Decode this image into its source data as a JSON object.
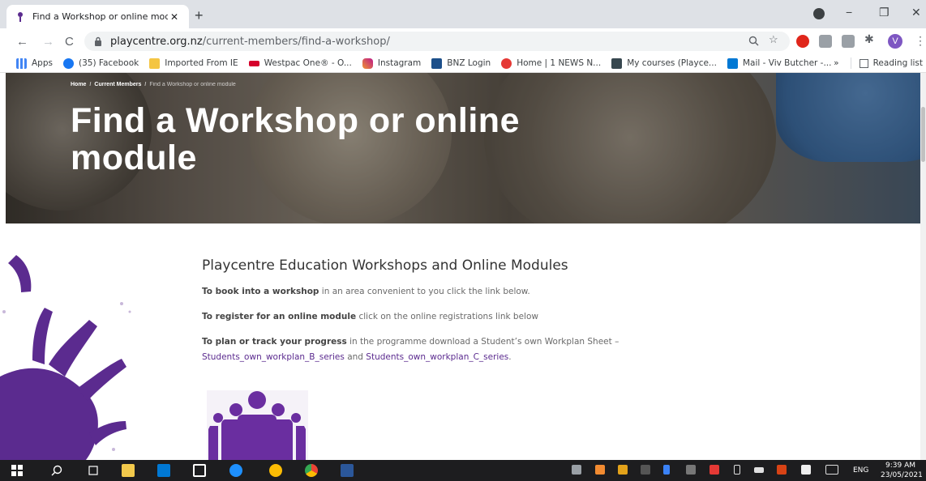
{
  "browser": {
    "tab": {
      "title": "Find a Workshop or online module",
      "close": "✕"
    },
    "new_tab": "+",
    "window_controls": {
      "minimize": "−",
      "restore": "❐",
      "close": "✕"
    },
    "nav": {
      "back": "←",
      "forward": "→",
      "reload": "C"
    },
    "url": {
      "host": "playcentre.org.nz",
      "path": "/current-members/find-a-workshop/"
    },
    "profile_initial": "V",
    "bookmarks": [
      {
        "label": "Apps",
        "color": "#4285f4"
      },
      {
        "label": "(35) Facebook",
        "color": "#1877f2"
      },
      {
        "label": "Imported From IE",
        "color": "#f4c542"
      },
      {
        "label": "Westpac One® - O...",
        "color": "#d5002b"
      },
      {
        "label": "Instagram",
        "color": "#c13584"
      },
      {
        "label": "BNZ Login",
        "color": "#1c4f8a"
      },
      {
        "label": "Home | 1 NEWS N...",
        "color": "#e53935"
      },
      {
        "label": "My courses (Playce...",
        "color": "#37474f"
      },
      {
        "label": "Mail - Viv Butcher -...",
        "color": "#0078d4"
      }
    ],
    "bookmarks_more": "»",
    "reading_list": "Reading list"
  },
  "hero": {
    "breadcrumb": [
      "Home",
      "Current Members",
      "Find a Workshop or online module"
    ],
    "breadcrumb_sep": "/",
    "title": "Find a Workshop or online module"
  },
  "content": {
    "heading": "Playcentre Education Workshops and Online Modules",
    "p1_bold": "To book into a workshop",
    "p1_rest": " in an area convenient to you click the link below.",
    "p2_bold": "To register for an online module",
    "p2_rest": " click on the online registrations link below",
    "p3_bold": "To plan or track your progress",
    "p3_rest": " in the programme download a Student’s own Workplan Sheet –",
    "link_b": "Students_own_workplan_B_series",
    "and": " and ",
    "link_c": "Students_own_workplan_C_series",
    "end": "."
  },
  "colors": {
    "accent_purple": "#5b2b8f",
    "link": "#5b2b8f"
  },
  "taskbar": {
    "lang": "ENG",
    "time": "9:39 AM",
    "date": "23/05/2021"
  }
}
